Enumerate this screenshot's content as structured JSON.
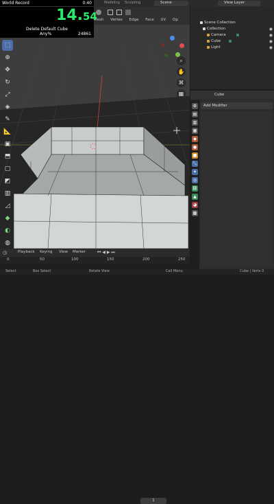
{
  "timer": {
    "title": "World Record",
    "wr_time": "0:40",
    "time_main": "14.",
    "time_frac": "54",
    "category_line1": "Delete Default Cube",
    "category_line2": "Any%",
    "attempts": "24861"
  },
  "topbar": {
    "workspaces": [
      "Modeling",
      "Sculpting"
    ],
    "scene": "Scene",
    "view_layer": "View Layer"
  },
  "viewport_menu": [
    "Mesh",
    "Vertex",
    "Edge",
    "Face",
    "UV",
    "Op"
  ],
  "toolbar_icons": [
    "select-box-icon",
    "cursor-icon",
    "move-icon",
    "rotate-icon",
    "scale-icon",
    "transform-icon",
    "annotate-icon",
    "measure-icon",
    "add-cube-icon",
    "extrude-icon",
    "inset-icon",
    "bevel-icon",
    "loop-cut-icon",
    "knife-icon",
    "poly-build-icon",
    "spin-icon",
    "smooth-icon",
    "edge-slide-icon",
    "shrink-icon",
    "shear-icon",
    "rip-icon"
  ],
  "timeline": {
    "menus": [
      "Playback",
      "Keying",
      "View",
      "Marker"
    ],
    "current_frame": "1",
    "ticks": [
      "0",
      "50",
      "100",
      "150",
      "200",
      "250"
    ]
  },
  "statusbar": {
    "items": [
      "Select",
      "Box Select",
      "Rotate View",
      "Call Menu"
    ],
    "right": "Cube | Verts 0"
  },
  "outliner": {
    "collection_root": "Scene Collection",
    "collection": "Collection",
    "objects": [
      "Camera",
      "Cube",
      "Light"
    ]
  },
  "properties": {
    "object_name": "Cube",
    "add_modifier": "Add Modifier"
  },
  "colors": {
    "timer_green": "#2ee86a",
    "accent_blue": "#4a6ea8",
    "x_axis": "#e04b54",
    "y_axis": "#7cc244",
    "z_axis": "#4a8ee6"
  }
}
